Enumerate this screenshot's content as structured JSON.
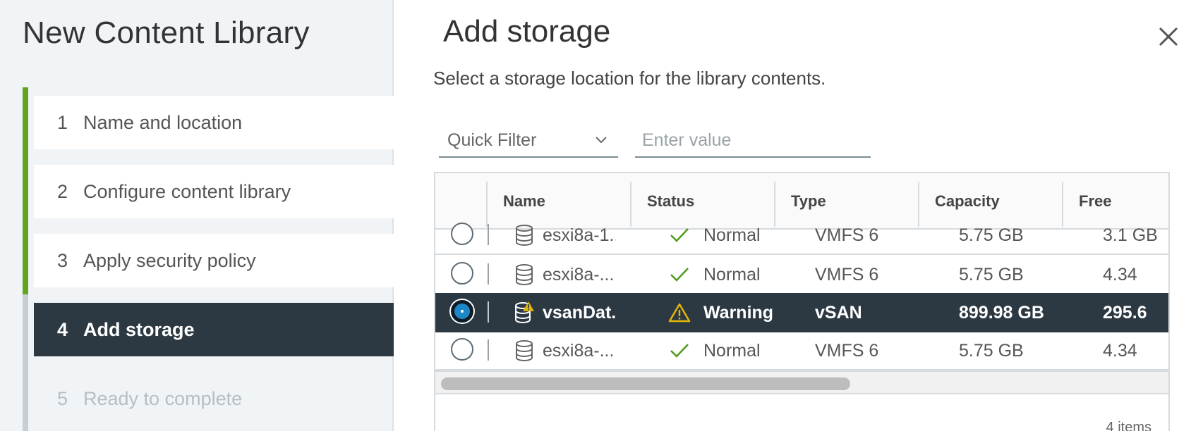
{
  "wizard": {
    "title": "New Content Library",
    "steps": [
      {
        "num": "1",
        "label": "Name and location"
      },
      {
        "num": "2",
        "label": "Configure content library"
      },
      {
        "num": "3",
        "label": "Apply security policy"
      },
      {
        "num": "4",
        "label": "Add storage"
      },
      {
        "num": "5",
        "label": "Ready to complete"
      }
    ],
    "active_step": 4
  },
  "page": {
    "title": "Add storage",
    "subtitle": "Select a storage location for the library contents."
  },
  "filter": {
    "select_value": "Quick Filter",
    "input_placeholder": "Enter value"
  },
  "grid": {
    "columns": [
      "Name",
      "Status",
      "Type",
      "Capacity",
      "Free"
    ],
    "rows": [
      {
        "name": "esxi8a-1...",
        "status": "Normal",
        "type": "VMFS 6",
        "capacity": "5.75 GB",
        "free": "3.1 GB",
        "selected": false,
        "status_kind": "ok"
      },
      {
        "name": "esxi8a-...",
        "status": "Normal",
        "type": "VMFS 6",
        "capacity": "5.75 GB",
        "free": "4.34",
        "selected": false,
        "status_kind": "ok"
      },
      {
        "name": "vsanDat...",
        "status": "Warning",
        "type": "vSAN",
        "capacity": "899.98 GB",
        "free": "295.6",
        "selected": true,
        "status_kind": "warning"
      },
      {
        "name": "esxi8a-...",
        "status": "Normal",
        "type": "VMFS 6",
        "capacity": "5.75 GB",
        "free": "4.34",
        "selected": false,
        "status_kind": "ok"
      }
    ],
    "footer": "4 items"
  },
  "colors": {
    "accent_green": "#62a420",
    "selected_row_bg": "#2c3943",
    "check_green": "#4e9a1b",
    "warning_yellow": "#e3b505",
    "radio_blue": "#1d87c8"
  },
  "icons": {
    "close": "close-icon",
    "chevron": "chevron-down-icon",
    "datastore": "datastore-icon",
    "check": "check-icon",
    "warning": "warning-icon"
  }
}
